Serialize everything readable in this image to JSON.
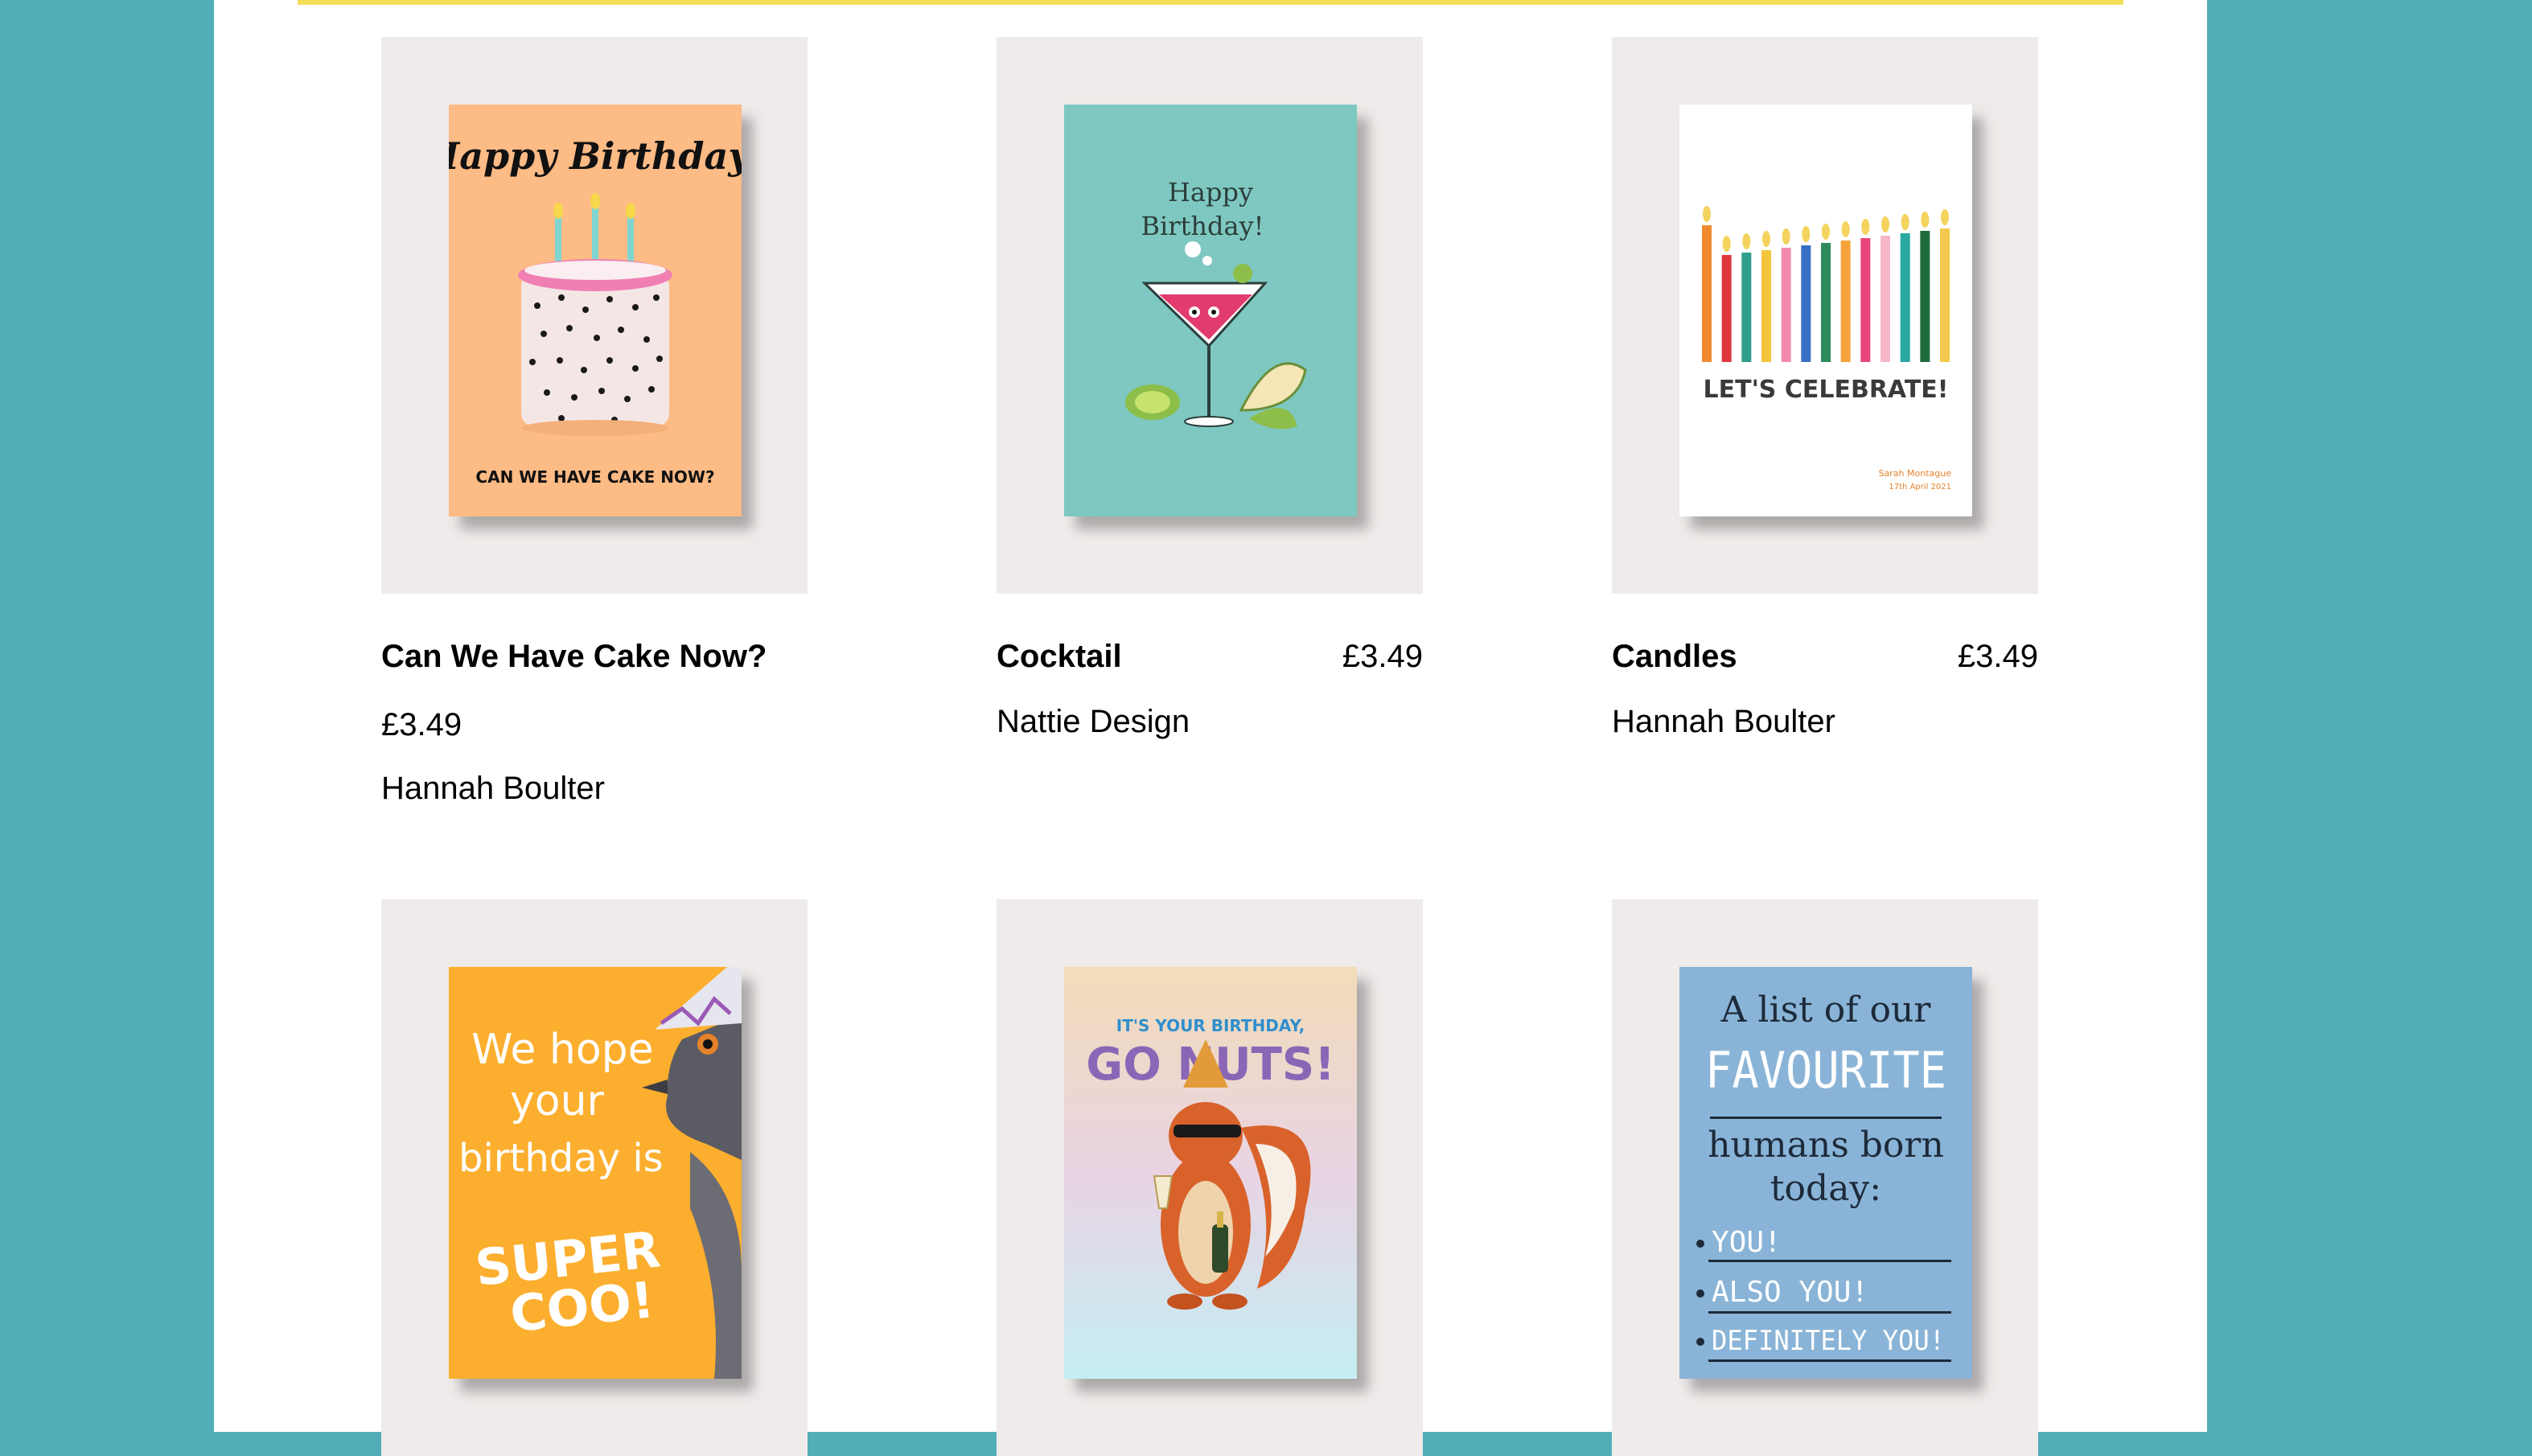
{
  "products": [
    {
      "title": "Can We Have Cake Now?",
      "price": "£3.49",
      "artist": "Hannah Boulter",
      "card": {
        "line1": "Happy Birthday!",
        "line2": "CAN WE HAVE CAKE NOW?",
        "bg": "#fdbb85"
      }
    },
    {
      "title": "Cocktail",
      "price": "£3.49",
      "artist": "Nattie Design",
      "card": {
        "line1": "Happy",
        "line2": "Birthday!",
        "bg": "#7ec8c1"
      }
    },
    {
      "title": "Candles",
      "price": "£3.49",
      "artist": "Hannah Boulter",
      "card": {
        "line1": "LET'S CELEBRATE!",
        "line2": "Sarah Montague",
        "line3": "17th April 2021",
        "bg": "#ffffff"
      }
    },
    {
      "card": {
        "line1": "We hope",
        "line2": "your",
        "line3": "birthday is",
        "line4": "SUPER",
        "line5": "COO!",
        "bg": "#fcae2e"
      }
    },
    {
      "card": {
        "line1": "IT'S YOUR BIRTHDAY,",
        "line2": "GO NUTS!",
        "bg": "#e8dcd3"
      }
    },
    {
      "card": {
        "line1": "A list of our",
        "line2": "FAVOURITE",
        "line3": "humans born",
        "line4": "today:",
        "line5": "YOU!",
        "line6": "ALSO YOU!",
        "line7": "DEFINITELY YOU!",
        "bg": "#89b4d7"
      }
    }
  ],
  "colors": {
    "background": "#51aeb8",
    "page": "#ffffff",
    "accent_rule": "#f4df5a",
    "thumb_bg": "#efebea"
  }
}
